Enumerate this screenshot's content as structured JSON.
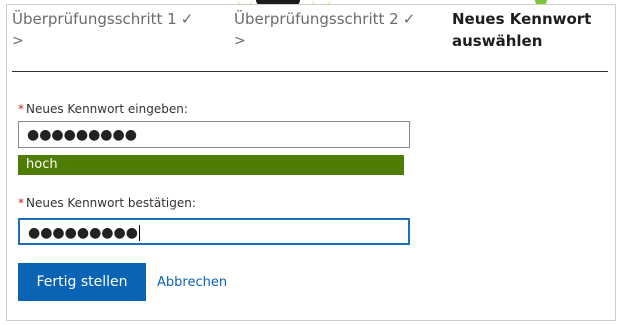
{
  "steps": [
    {
      "label": "Überprüfungsschritt 1",
      "check": "✓",
      "next": ">"
    },
    {
      "label": "Überprüfungsschritt 2",
      "check": "✓",
      "next": ">"
    },
    {
      "label": "Neues Kennwort\nauswählen"
    }
  ],
  "form": {
    "required_marker": "*",
    "new_password_label": "Neues Kennwort eingeben:",
    "new_password_value": "●●●●●●●●●",
    "strength_text": "hoch",
    "confirm_password_label": "Neues Kennwort bestätigen:",
    "confirm_password_value": "●●●●●●●●●"
  },
  "actions": {
    "submit_label": "Fertig stellen",
    "cancel_label": "Abbrechen"
  },
  "colors": {
    "primary_button": "#0a64b6",
    "strength_bar": "#4d7c00",
    "required_marker": "#c62828",
    "focused_input_border": "#1a6fbf",
    "link": "#0b63b4"
  }
}
